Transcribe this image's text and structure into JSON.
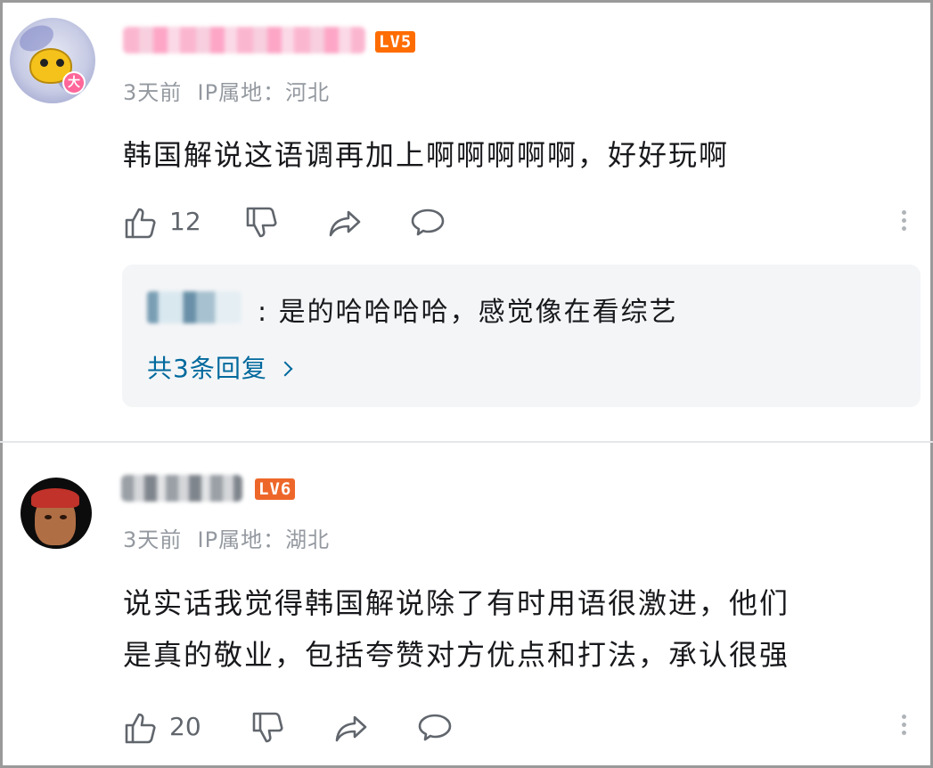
{
  "comments": [
    {
      "level": "LV5",
      "time": "3天前",
      "ip": "IP属地：河北",
      "avatar_badge": "大",
      "text": "韩国解说这语调再加上啊啊啊啊啊，好好玩啊",
      "likes": "12",
      "reply_preview": {
        "text": ": 是的哈哈哈哈，感觉像在看综艺",
        "more_label": "共3条回复"
      }
    },
    {
      "level": "LV6",
      "time": "3天前",
      "ip": "IP属地：湖北",
      "text_line1": "说实话我觉得韩国解说除了有时用语很激进，他们",
      "text_line2": "是真的敬业，包括夸赞对方优点和打法，承认很强",
      "likes": "20"
    }
  ],
  "icons": [
    "like-icon",
    "dislike-icon",
    "share-icon",
    "reply-icon",
    "more-icon",
    "chevron-right-icon"
  ],
  "colors": {
    "level5": "#ff6c00",
    "level6": "#ee672a",
    "meta_text": "#9499a0",
    "reply_link": "#00699d",
    "reply_bg": "#f4f5f7"
  }
}
